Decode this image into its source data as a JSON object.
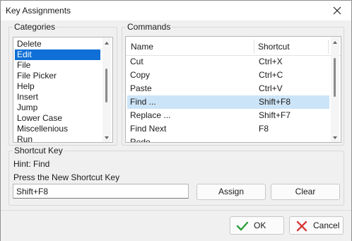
{
  "window": {
    "title": "Key Assignments"
  },
  "categories": {
    "label": "Categories",
    "items": [
      "Delete",
      "Edit",
      "File",
      "File Picker",
      "Help",
      "Insert",
      "Jump",
      "Lower Case",
      "Miscellenious",
      "Run"
    ],
    "selected_index": 1
  },
  "commands": {
    "label": "Commands",
    "columns": [
      "Name",
      "Shortcut"
    ],
    "rows": [
      {
        "name": "Cut",
        "shortcut": "Ctrl+X"
      },
      {
        "name": "Copy",
        "shortcut": "Ctrl+C"
      },
      {
        "name": "Paste",
        "shortcut": "Ctrl+V"
      },
      {
        "name": "Find ...",
        "shortcut": "Shift+F8"
      },
      {
        "name": "Replace ...",
        "shortcut": "Shift+F7"
      },
      {
        "name": "Find Next",
        "shortcut": "F8"
      },
      {
        "name": "Redo",
        "shortcut": ""
      }
    ],
    "selected_index": 3
  },
  "shortcut_key": {
    "label": "Shortcut Key",
    "hint": "Hint: Find",
    "prompt": "Press the New Shortcut Key",
    "value": "Shift+F8",
    "assign_label": "Assign",
    "clear_label": "Clear"
  },
  "footer": {
    "ok_label": "OK",
    "cancel_label": "Cancel"
  },
  "colors": {
    "selection": "#0f6fd6",
    "row_highlight": "#cce4f7",
    "ok_check": "#2e9e3a",
    "cancel_x": "#d63a3a"
  },
  "icons": {
    "close": "close-icon",
    "ok": "checkmark-icon",
    "cancel": "cancel-x-icon"
  }
}
